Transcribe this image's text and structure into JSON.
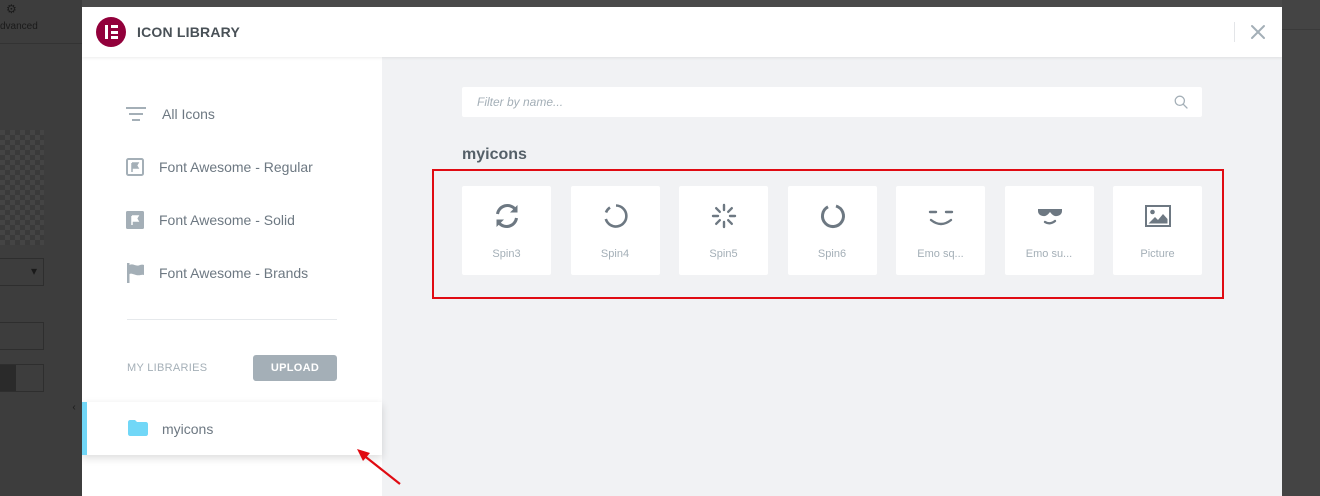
{
  "background": {
    "advanced_label": "dvanced"
  },
  "modal": {
    "title": "ICON LIBRARY",
    "brand_color": "#92003b"
  },
  "sidebar": {
    "items": [
      {
        "label": "All Icons",
        "icon": "filter-lines-icon"
      },
      {
        "label": "Font Awesome - Regular",
        "icon": "flag-regular-icon"
      },
      {
        "label": "Font Awesome - Solid",
        "icon": "flag-solid-icon"
      },
      {
        "label": "Font Awesome - Brands",
        "icon": "flag-brands-icon"
      }
    ],
    "my_libraries_label": "MY LIBRARIES",
    "upload_label": "UPLOAD",
    "libraries": [
      {
        "label": "myicons",
        "icon": "folder-icon",
        "active": true,
        "accent_color": "#71d7f7"
      }
    ]
  },
  "main": {
    "search_placeholder": "Filter by name...",
    "section_title": "myicons",
    "icons": [
      {
        "label": "Spin3",
        "icon": "spin3-icon"
      },
      {
        "label": "Spin4",
        "icon": "spin4-icon"
      },
      {
        "label": "Spin5",
        "icon": "spin5-icon"
      },
      {
        "label": "Spin6",
        "icon": "spin6-icon"
      },
      {
        "label": "Emo sq...",
        "icon": "emo-squint-icon"
      },
      {
        "label": "Emo su...",
        "icon": "emo-sunglasses-icon"
      },
      {
        "label": "Picture",
        "icon": "picture-icon"
      }
    ]
  },
  "annotation": {
    "highlight_color": "#e00b12"
  }
}
